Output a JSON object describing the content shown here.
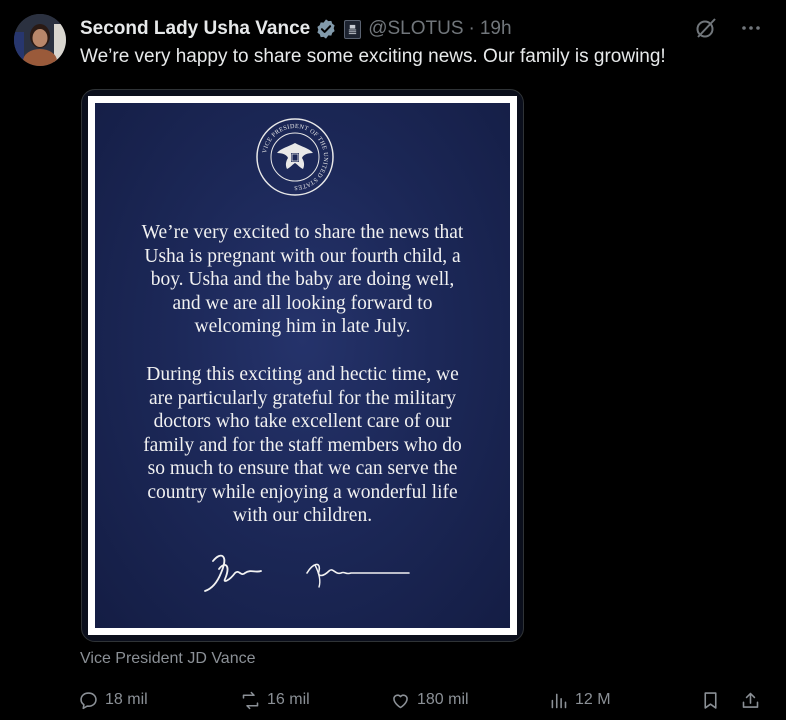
{
  "author": {
    "name": "Second Lady Usha Vance",
    "handle": "@SLOTUS",
    "separator": "·",
    "time": "19h"
  },
  "tweet": {
    "text": "We’re very happy to share some exciting news. Our family is growing!"
  },
  "letter": {
    "seal_text": "VICE PRESIDENT OF THE UNITED STATES",
    "paragraph1": [
      "We’re very excited to share the news that",
      "Usha is pregnant with our fourth child, a",
      "boy. Usha and the baby are doing well,",
      "and we are all looking forward to",
      "welcoming him in late July."
    ],
    "paragraph2": [
      "During this exciting and hectic time, we",
      "are particularly grateful for the military",
      "doctors who take excellent care of our",
      "family and for the staff members who do",
      "so much to ensure that we can serve the",
      "country while enjoying a wonderful life",
      "with our children."
    ]
  },
  "media_caption": "Vice President JD Vance",
  "actions": {
    "replies": "18 mil",
    "reposts": "16 mil",
    "likes": "180 mil",
    "views": "12 M"
  },
  "colors": {
    "background": "#000000",
    "text": "#e7e9ea",
    "muted": "#71767b",
    "verified": "#829aab",
    "panel": "#1c2858"
  }
}
